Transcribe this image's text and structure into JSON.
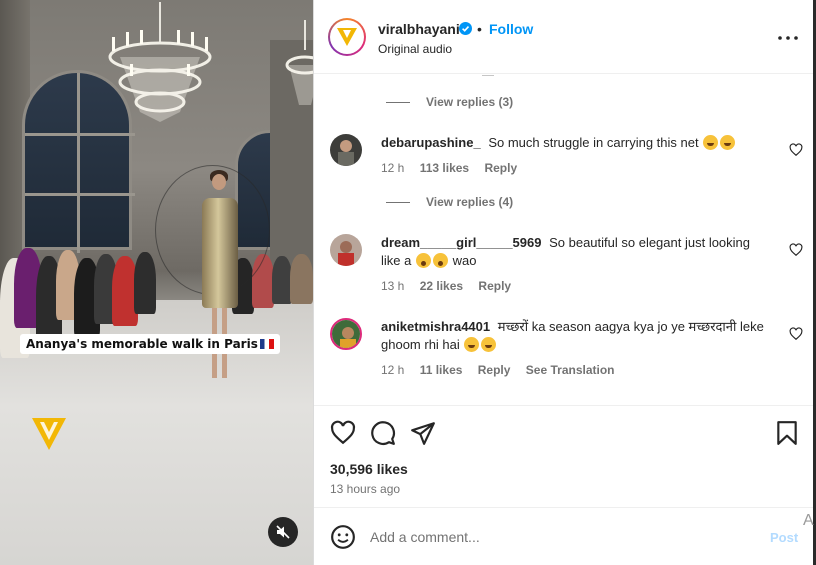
{
  "media": {
    "caption": "Ananya's memorable walk in Paris",
    "mute_icon": "speaker-muted-icon"
  },
  "header": {
    "username": "viralbhayani",
    "separator": "•",
    "follow_label": "Follow",
    "audio": "Original audio",
    "more_icon": "more-horizontal-icon"
  },
  "comments": {
    "truncated_text": "—",
    "replies_1": "View replies (3)",
    "replies_2": "View replies (4)",
    "items": [
      {
        "username": "debarupashine_",
        "text": "So much struggle in carrying this net",
        "time": "12 h",
        "likes": "113 likes",
        "reply": "Reply"
      },
      {
        "username": "dream_____girl_____5969",
        "text": "So beautiful so elegant just looking like a",
        "text_after": "wao",
        "time": "13 h",
        "likes": "22 likes",
        "reply": "Reply"
      },
      {
        "username": "aniketmishra4401",
        "text": "मच्छरों ka season aagya kya jo ye मच्छरदानी leke ghoom rhi hai",
        "time": "12 h",
        "likes": "11 likes",
        "reply": "Reply",
        "translation": "See Translation"
      }
    ]
  },
  "actions": {
    "likes": "30,596 likes",
    "time_ago": "13 hours ago"
  },
  "add_comment": {
    "placeholder": "Add a comment...",
    "post_label": "Post"
  },
  "edge_letter": "A",
  "colors": {
    "accent": "#0095f6",
    "text": "#262626",
    "muted": "#737373"
  }
}
